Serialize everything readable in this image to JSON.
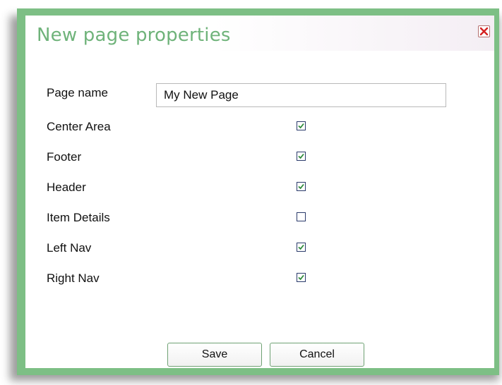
{
  "dialog": {
    "title": "New page properties",
    "close_icon": "close-icon"
  },
  "form": {
    "page_name_label": "Page name",
    "page_name_value": "My New Page",
    "options": [
      {
        "label": "Center Area",
        "checked": true
      },
      {
        "label": "Footer",
        "checked": true
      },
      {
        "label": "Header",
        "checked": true
      },
      {
        "label": "Item Details",
        "checked": false
      },
      {
        "label": "Left Nav",
        "checked": true
      },
      {
        "label": "Right Nav",
        "checked": true
      }
    ]
  },
  "buttons": {
    "save_label": "Save",
    "cancel_label": "Cancel"
  },
  "colors": {
    "border_green": "#7dbf85",
    "title_green": "#6fb37a",
    "check_green": "#2e8b3a"
  }
}
